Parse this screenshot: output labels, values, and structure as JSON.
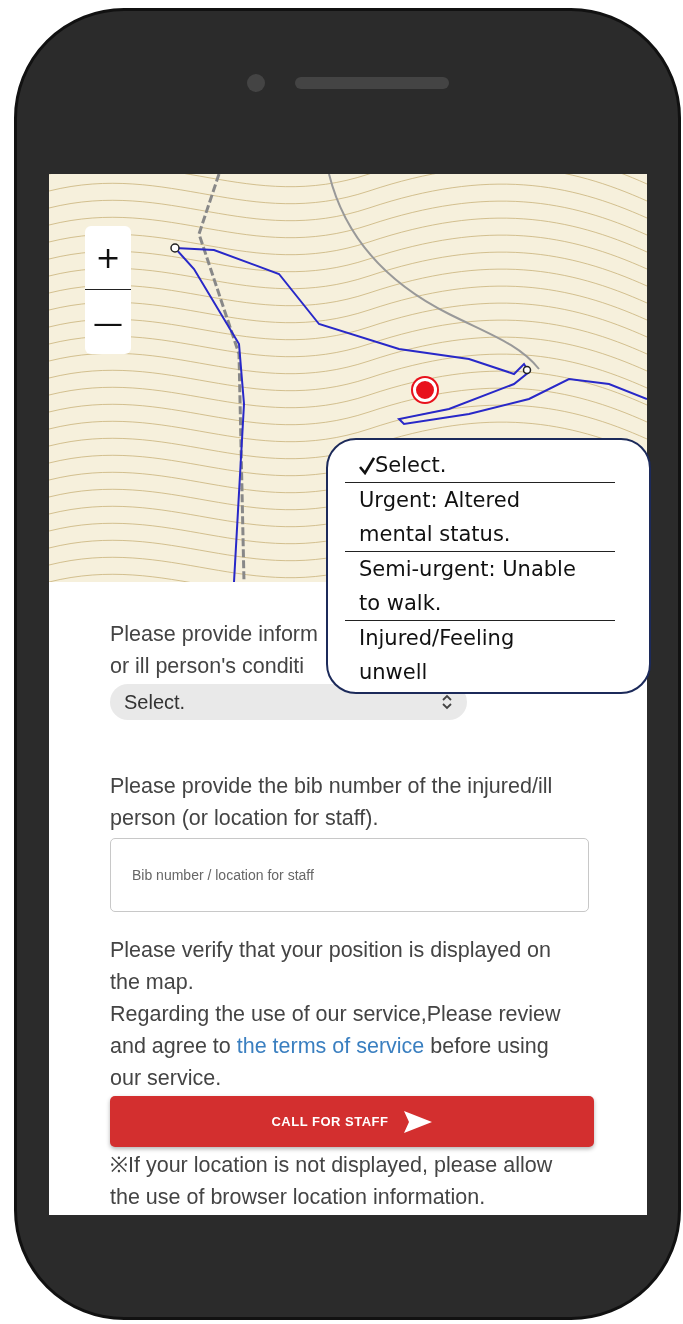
{
  "map": {
    "zoom_in": "+",
    "zoom_out": "—"
  },
  "condition": {
    "label_lines": [
      "Please provide inform",
      "or ill person's conditi"
    ],
    "select_value": "Select.",
    "options": [
      {
        "label": "Select.",
        "selected": true
      },
      {
        "label": "Urgent: Altered mental status.",
        "selected": false
      },
      {
        "label": "Semi-urgent: Unable to walk.",
        "selected": false
      },
      {
        "label": "Injured/Feeling unwell",
        "selected": false
      }
    ]
  },
  "bib": {
    "label": "Please provide the bib number of the injured/ill person (or location for staff).",
    "placeholder": "Bib number / location for staff"
  },
  "verify_text": "Please verify that your position is displayed on the map.",
  "terms": {
    "before": "Regarding the use of our service,Please review and agree to ",
    "link": "the terms of service",
    "after": " before using our service."
  },
  "call_button": "CALL FOR STAFF",
  "footnote": "※If your location is not displayed, please allow the use of browser location information."
}
